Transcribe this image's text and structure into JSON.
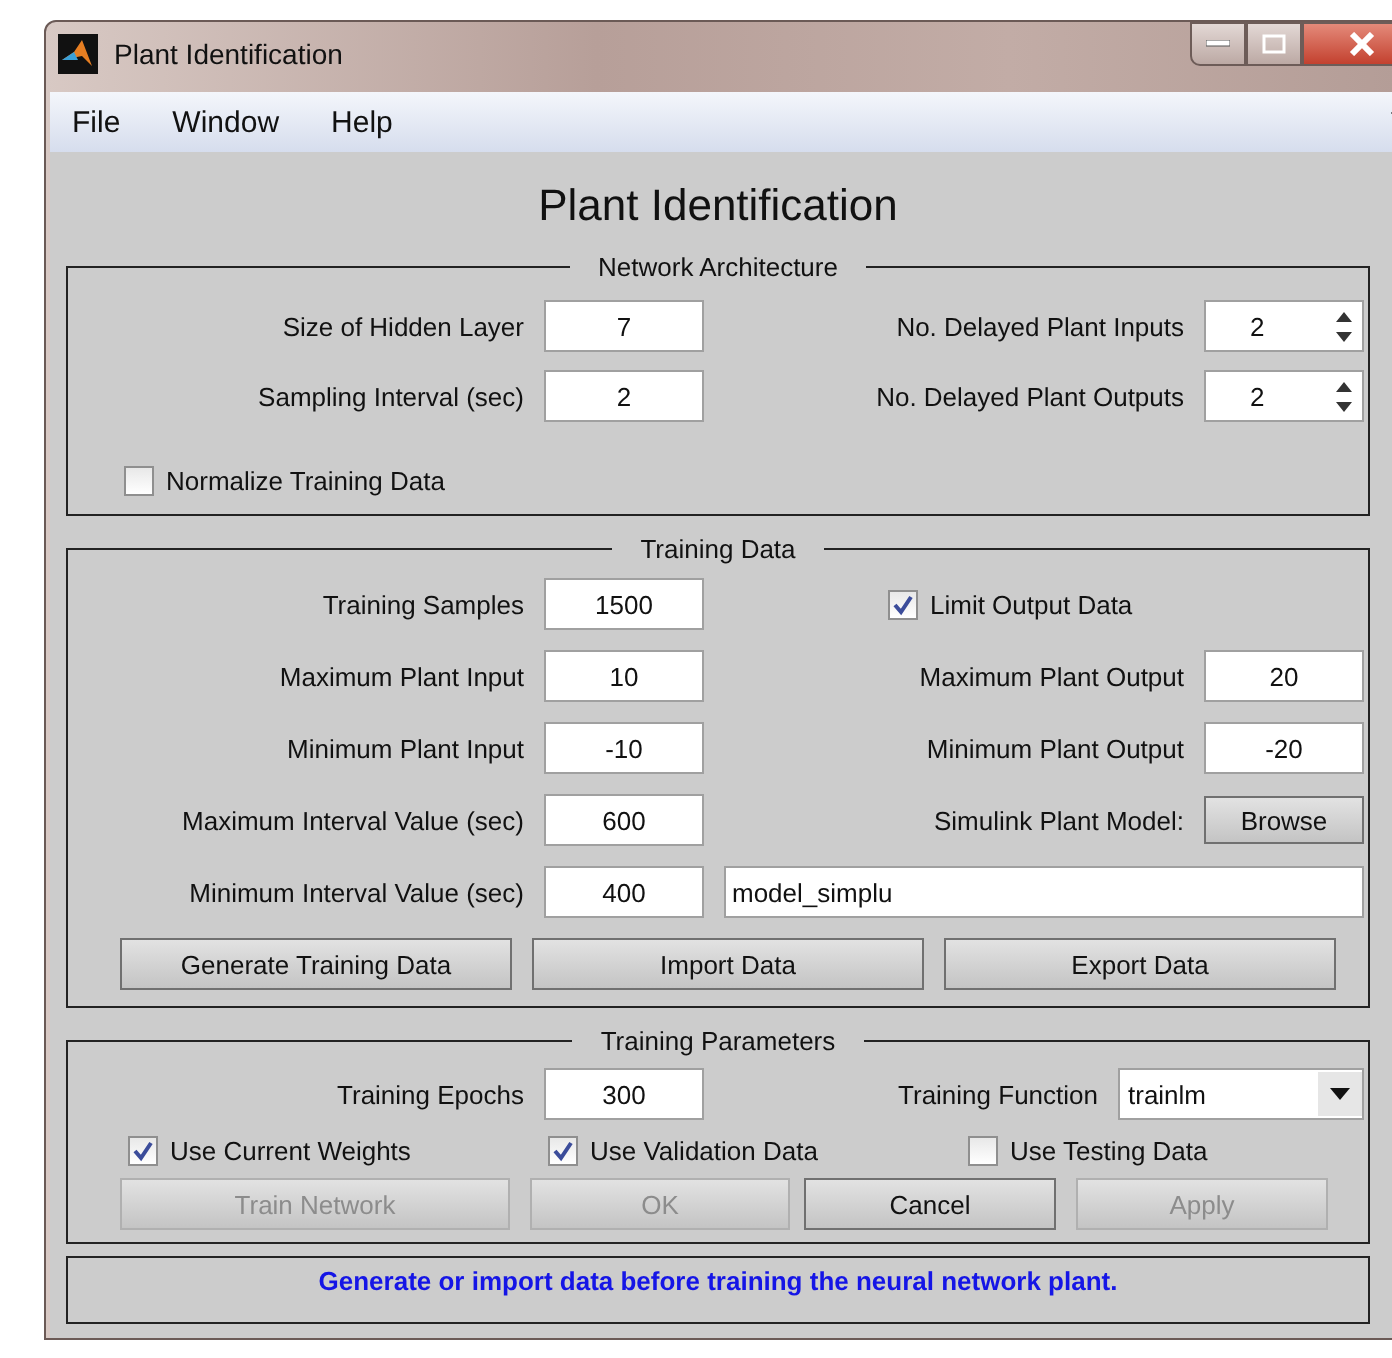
{
  "window": {
    "title": "Plant Identification"
  },
  "menu": [
    "File",
    "Window",
    "Help"
  ],
  "heading": "Plant Identification",
  "network_architecture": {
    "title": "Network Architecture",
    "rows": [
      {
        "left": {
          "label": "Size of Hidden Layer",
          "value": "7"
        },
        "right": {
          "label": "No. Delayed Plant Inputs",
          "value": "2"
        }
      },
      {
        "left": {
          "label": "Sampling Interval (sec)",
          "value": "2"
        },
        "right": {
          "label": "No. Delayed Plant Outputs",
          "value": "2"
        }
      }
    ],
    "normalize": {
      "label": "Normalize Training Data",
      "checked": false
    }
  },
  "training_data": {
    "title": "Training Data",
    "samples": {
      "label": "Training Samples",
      "value": "1500"
    },
    "limit_output": {
      "label": "Limit Output Data",
      "checked": true
    },
    "rows": [
      {
        "left": {
          "label": "Maximum Plant Input",
          "value": "10"
        },
        "right": {
          "label": "Maximum Plant Output",
          "value": "20"
        }
      },
      {
        "left": {
          "label": "Minimum Plant Input",
          "value": "-10"
        },
        "right": {
          "label": "Minimum Plant Output",
          "value": "-20"
        }
      }
    ],
    "max_interval": {
      "label": "Maximum Interval Value (sec)",
      "value": "600"
    },
    "simulink": {
      "label": "Simulink Plant Model:",
      "button": "Browse"
    },
    "min_interval": {
      "label": "Minimum Interval Value (sec)",
      "value": "400"
    },
    "model_name": "model_simplu",
    "buttons": [
      {
        "label": "Generate Training Data",
        "disabled": false
      },
      {
        "label": "Import Data",
        "disabled": false
      },
      {
        "label": "Export Data",
        "disabled": false
      }
    ]
  },
  "training_parameters": {
    "title": "Training Parameters",
    "epochs": {
      "label": "Training Epochs",
      "value": "300"
    },
    "function": {
      "label": "Training Function",
      "value": "trainlm"
    },
    "checkboxes": [
      {
        "label": "Use Current Weights",
        "checked": true
      },
      {
        "label": "Use Validation Data",
        "checked": true
      },
      {
        "label": "Use Testing Data",
        "checked": false
      }
    ],
    "buttons": [
      {
        "label": "Train Network",
        "disabled": true
      },
      {
        "label": "OK",
        "disabled": true
      },
      {
        "label": "Cancel",
        "disabled": false
      },
      {
        "label": "Apply",
        "disabled": true
      }
    ]
  },
  "status": "Generate or import data before training the neural network plant."
}
